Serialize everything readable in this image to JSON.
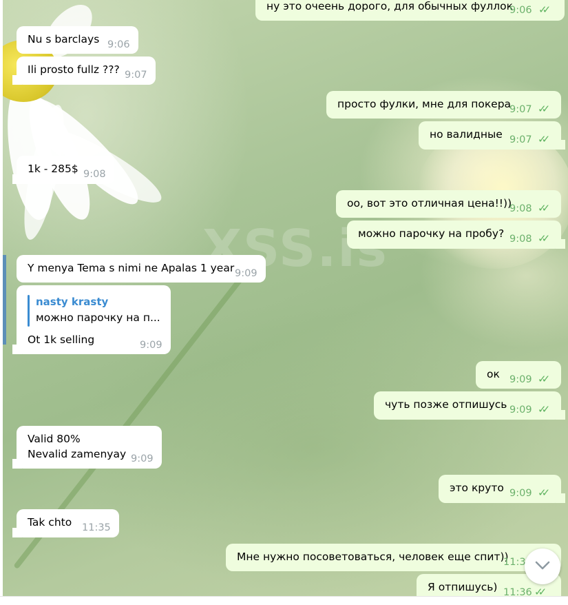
{
  "background": {
    "watermark": "XSS.is"
  },
  "messages": [
    {
      "dir": "out",
      "text": "ну это очеень дорого, для обычных фуллок",
      "time": "9:06",
      "read": true
    },
    {
      "dir": "in",
      "text": "Nu s barclays",
      "time": "9:06"
    },
    {
      "dir": "in",
      "text": "Ili prosto fullz ???",
      "time": "9:07"
    },
    {
      "dir": "out",
      "text": "просто фулки, мне для покера",
      "time": "9:07",
      "read": true
    },
    {
      "dir": "out",
      "text": "но валидные",
      "time": "9:07",
      "read": true
    },
    {
      "dir": "in",
      "text": "1k - 285$",
      "time": "9:08"
    },
    {
      "dir": "out",
      "text": "оо, вот это отличная цена!!))",
      "time": "9:08",
      "read": true
    },
    {
      "dir": "out",
      "text": "можно парочку на пробу?",
      "time": "9:08",
      "read": true
    },
    {
      "dir": "in",
      "text": "Y menya Tema s nimi ne Apalas 1 year",
      "time": "9:09"
    },
    {
      "dir": "in",
      "reply_name": "nasty krasty",
      "reply_text": "можно парочку на п...",
      "text": "Ot 1k selling",
      "time": "9:09"
    },
    {
      "dir": "out",
      "text": "ок",
      "time": "9:09",
      "read": true
    },
    {
      "dir": "out",
      "text": "чуть позже отпишусь",
      "time": "9:09",
      "read": true
    },
    {
      "dir": "in",
      "text_line1": "Valid 80%",
      "text_line2": "Nevalid zamenyay",
      "time": "9:09"
    },
    {
      "dir": "out",
      "text": "это круто",
      "time": "9:09",
      "read": true
    },
    {
      "dir": "in",
      "text": "Tak chto",
      "time": "11:35"
    },
    {
      "dir": "out",
      "text": "Мне нужно посоветоваться, человек еще спит))",
      "time": "11:35",
      "read": true
    },
    {
      "dir": "out",
      "text": "Я отпишусь)",
      "time": "11:36",
      "read": true
    }
  ],
  "read_mark": "✓✓",
  "scroll_button": {
    "icon": "chevron-down-icon"
  }
}
